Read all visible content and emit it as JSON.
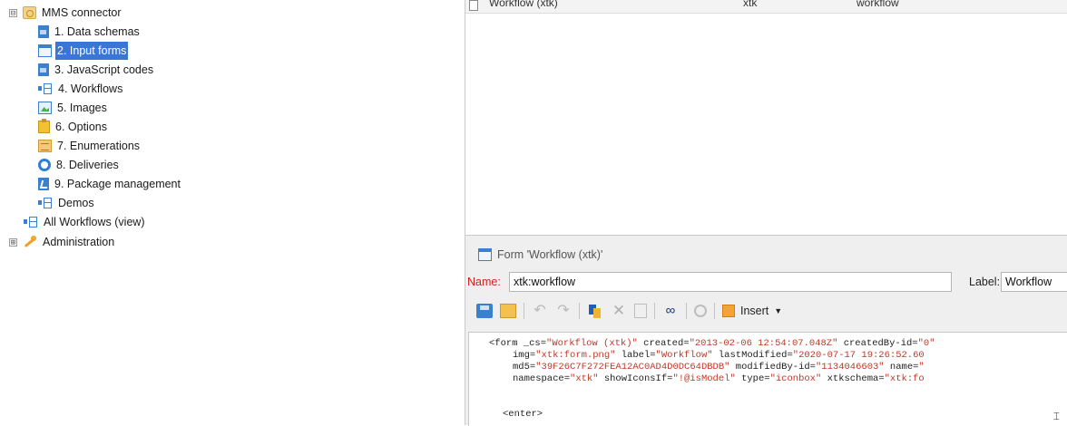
{
  "tree": {
    "root": {
      "label": "MMS connector",
      "expander": "⊟"
    },
    "children": [
      {
        "label": "1. Data schemas",
        "icon": "schema-icon"
      },
      {
        "label": "2. Input forms",
        "icon": "form-icon",
        "selected": true
      },
      {
        "label": "3. JavaScript codes",
        "icon": "script-icon"
      },
      {
        "label": "4. Workflows",
        "icon": "workflow-icon"
      },
      {
        "label": "5. Images",
        "icon": "image-icon"
      },
      {
        "label": "6. Options",
        "icon": "options-icon"
      },
      {
        "label": "7. Enumerations",
        "icon": "enumeration-icon"
      },
      {
        "label": "8. Deliveries",
        "icon": "delivery-icon"
      },
      {
        "label": "9. Package management",
        "icon": "package-icon"
      },
      {
        "label": "Demos",
        "icon": "workflow-icon"
      }
    ],
    "all_workflows": "All Workflows (view)",
    "administration": {
      "label": "Administration",
      "expander": "⊞"
    }
  },
  "list": {
    "row": {
      "col1": "Workflow (xtk)",
      "col2": "xtk",
      "col3": "workflow"
    }
  },
  "form": {
    "title": "Form 'Workflow (xtk)'",
    "name_label": "Name:",
    "name_value": "xtk:workflow",
    "label_label": "Label:",
    "label_value": "Workflow",
    "insert_label": "Insert"
  },
  "code": {
    "line1_a": "<form _cs=",
    "line1_v1": "\"Workflow (xtk)\"",
    "line1_b": " created=",
    "line1_v2": "\"2013-02-06 12:54:07.048Z\"",
    "line1_c": " createdBy-id=",
    "line1_v3": "\"0\"",
    "line2_a": "img=",
    "line2_v1": "\"xtk:form.png\"",
    "line2_b": " label=",
    "line2_v2": "\"Workflow\"",
    "line2_c": " lastModified=",
    "line2_v3": "\"2020-07-17 19:26:52.60",
    "line3_a": "md5=",
    "line3_v1": "\"39F26C7F272FEA12AC0AD4D0DC64DBDB\"",
    "line3_b": " modifiedBy-id=",
    "line3_v2": "\"1134046603\"",
    "line3_c": " name=",
    "line3_v3": "\"",
    "line4_a": "namespace=",
    "line4_v1": "\"xtk\"",
    "line4_b": " showIconsIf=",
    "line4_v2": "\"!@isModel\"",
    "line4_c": " type=",
    "line4_v3": "\"iconbox\"",
    "line4_d": " xtkschema=",
    "line4_v4": "\"xtk:fo",
    "line5": "<enter>"
  }
}
